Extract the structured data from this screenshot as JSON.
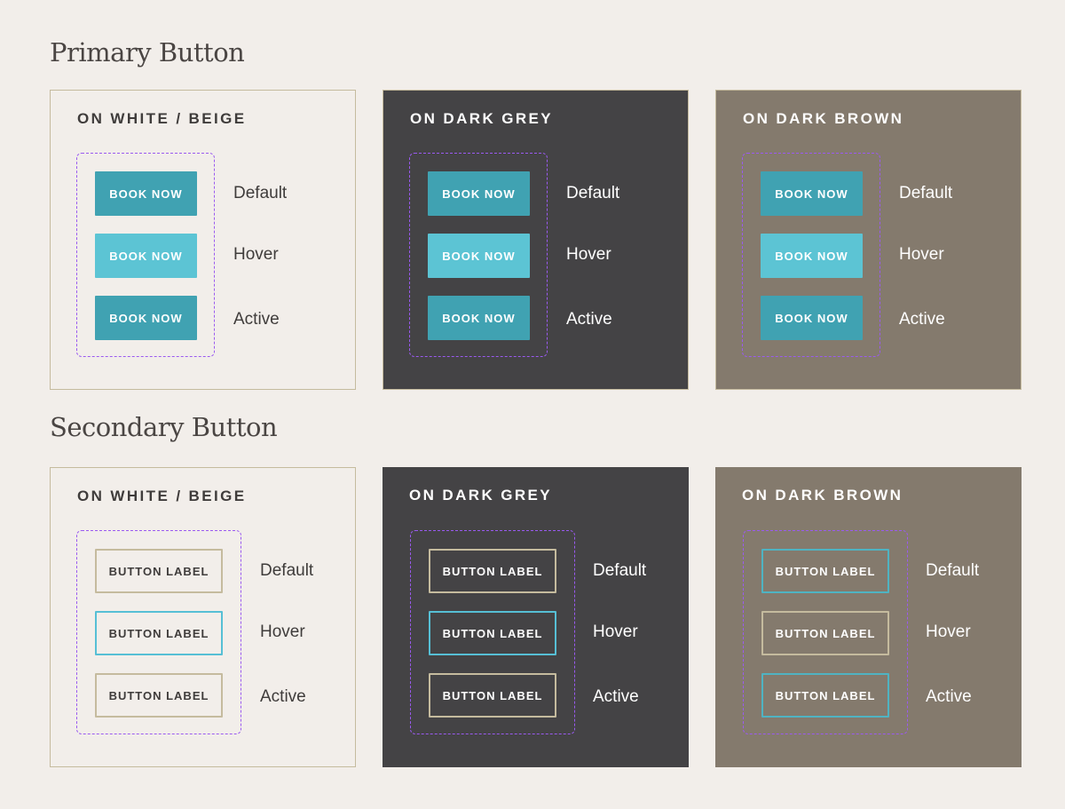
{
  "colors": {
    "page_bg": "#f2eeea",
    "teal_default": "#40a2b2",
    "teal_hover": "#5cc4d4",
    "dark_grey": "#444345",
    "dark_brown": "#847a6d",
    "beige_border": "#c5bb9e",
    "outline_cyan": "#56bfd5",
    "guide_purple": "#9a5af0"
  },
  "primary": {
    "title": "Primary Button",
    "panels": [
      {
        "title": "ON WHITE / BEIGE",
        "buttons": [
          "BOOK NOW",
          "BOOK NOW",
          "BOOK NOW"
        ],
        "states": [
          "Default",
          "Hover",
          "Active"
        ]
      },
      {
        "title": "ON DARK GREY",
        "buttons": [
          "BOOK NOW",
          "BOOK NOW",
          "BOOK NOW"
        ],
        "states": [
          "Default",
          "Hover",
          "Active"
        ]
      },
      {
        "title": "ON DARK BROWN",
        "buttons": [
          "BOOK NOW",
          "BOOK NOW",
          "BOOK NOW"
        ],
        "states": [
          "Default",
          "Hover",
          "Active"
        ]
      }
    ]
  },
  "secondary": {
    "title": "Secondary Button",
    "panels": [
      {
        "title": "ON WHITE / BEIGE",
        "buttons": [
          "BUTTON LABEL",
          "BUTTON LABEL",
          "BUTTON LABEL"
        ],
        "states": [
          "Default",
          "Hover",
          "Active"
        ]
      },
      {
        "title": "ON DARK GREY",
        "buttons": [
          "BUTTON LABEL",
          "BUTTON LABEL",
          "BUTTON LABEL"
        ],
        "states": [
          "Default",
          "Hover",
          "Active"
        ]
      },
      {
        "title": "ON DARK BROWN",
        "buttons": [
          "BUTTON LABEL",
          "BUTTON LABEL",
          "BUTTON LABEL"
        ],
        "states": [
          "Default",
          "Hover",
          "Active"
        ]
      }
    ]
  }
}
